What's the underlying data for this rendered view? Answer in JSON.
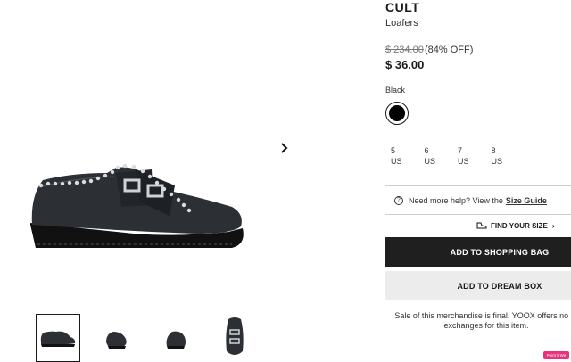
{
  "product": {
    "brand": "CULT",
    "category": "Loafers",
    "original_price": "$ 234.00",
    "discount": "(84% OFF)",
    "price": "$ 36.00",
    "color_label": "Black",
    "swatch_color": "#000000"
  },
  "sizes": [
    {
      "number": "5",
      "unit": "US"
    },
    {
      "number": "6",
      "unit": "US"
    },
    {
      "number": "7",
      "unit": "US"
    },
    {
      "number": "8",
      "unit": "US"
    }
  ],
  "help": {
    "text": "Need more help? View the",
    "link": "Size Guide"
  },
  "find_size": {
    "label": "FIND YOUR SIZE"
  },
  "actions": {
    "add_to_bag": "ADD TO SHOPPING BAG",
    "add_to_dream_box": "ADD TO DREAM BOX"
  },
  "note": "Sale of this merchandise is final. YOOX offers no or exchanges for this item.",
  "badge": "Point it We",
  "icons": {
    "next": "chevron-right-icon",
    "help": "question-circle-icon",
    "find_size": "shoe-icon",
    "find_size_arrow": "chevron-right-icon"
  },
  "thumbnails": [
    "side view",
    "front angle",
    "back angle",
    "top view"
  ]
}
